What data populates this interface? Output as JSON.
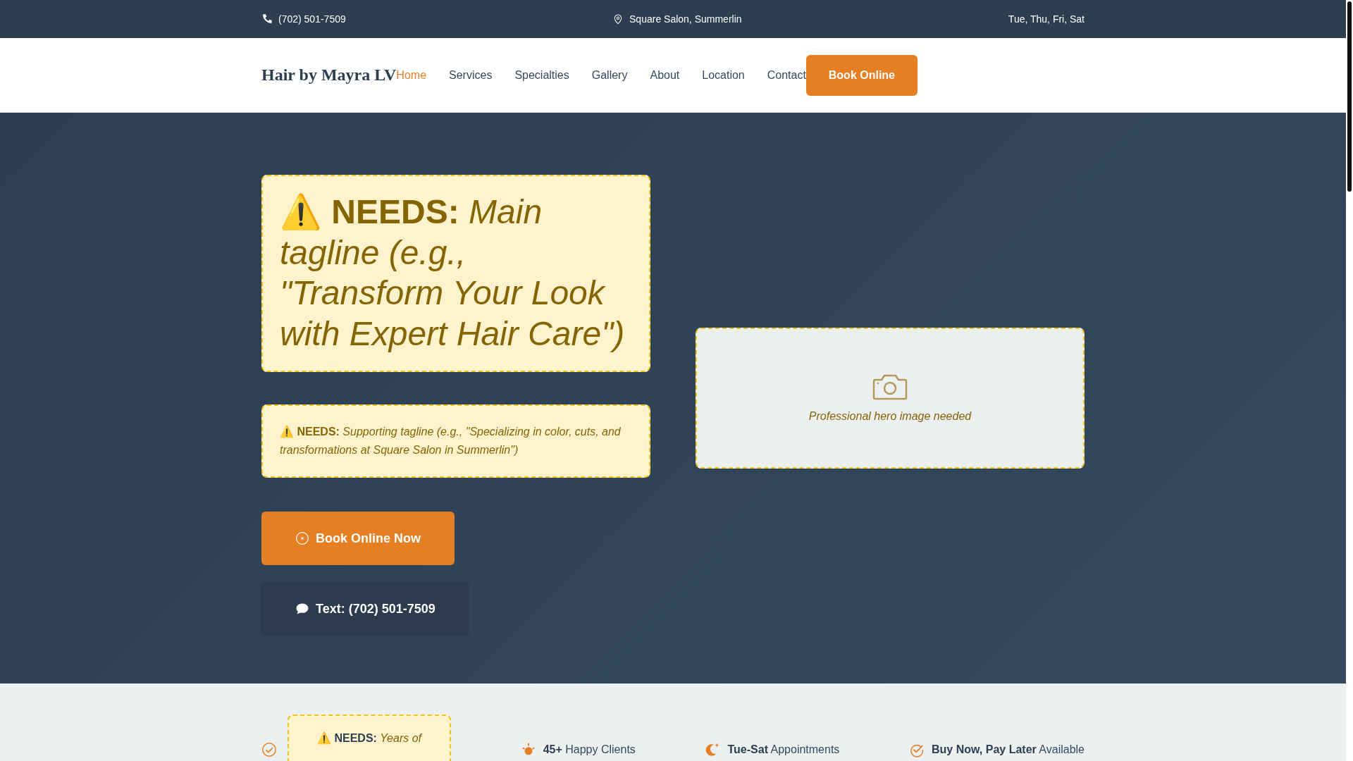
{
  "top_bar": {
    "phone": "(702) 501-7509",
    "location": "Square Salon, Summerlin",
    "hours": "Tue, Thu, Fri, Sat"
  },
  "nav": {
    "logo": "Hair by Mayra LV",
    "links": [
      {
        "label": "Home",
        "selected": true
      },
      {
        "label": "Services",
        "selected": false
      },
      {
        "label": "Specialties",
        "selected": false
      },
      {
        "label": "Gallery",
        "selected": false
      },
      {
        "label": "About",
        "selected": false
      },
      {
        "label": "Location",
        "selected": false
      },
      {
        "label": "Contact",
        "selected": false
      }
    ],
    "cta": "Book Online"
  },
  "hero": {
    "tagline": "⚠️ **NEEDS:** *Main tagline (e.g., \"Transform Your Look with Expert Hair Care\")*",
    "subtagline": "⚠️ **NEEDS:** *Supporting tagline (e.g., \"Specializing in color, cuts, and transformations at Square Salon in Summerlin\")*",
    "buttons": [
      {
        "kind": "primary",
        "label": "Book Online Now"
      },
      {
        "kind": "secondary",
        "label": "Text: (702) 501-7509"
      }
    ],
    "image_placeholder": "Professional hero image needed"
  },
  "stats": [
    {
      "kind": "needs",
      "text": "⚠️ **NEEDS:** *Years of*"
    },
    {
      "kind": "stat",
      "text": "**45+** Happy Clients"
    },
    {
      "kind": "stat",
      "text": "**Tue-Sat** Appointments"
    },
    {
      "kind": "stat",
      "text": "**Buy Now, Pay Later** Available"
    }
  ]
}
